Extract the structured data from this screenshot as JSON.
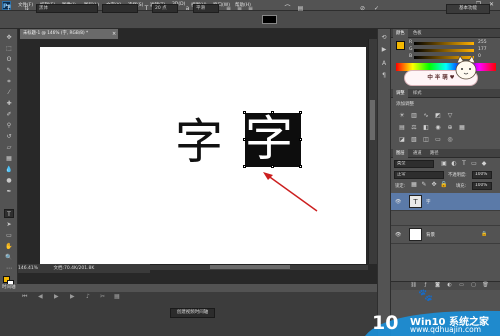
{
  "app": {
    "logo": "Ps"
  },
  "menu": [
    "文件(F)",
    "编辑(E)",
    "图像(I)",
    "图层(L)",
    "文字(Y)",
    "选择(S)",
    "滤镜(T)",
    "3D(D)",
    "视图(V)",
    "窗口(W)",
    "帮助(H)"
  ],
  "window_controls": [
    "—",
    "❐",
    "✕"
  ],
  "options": {
    "font_family": "黑体",
    "font_size": "20 点",
    "antialias": "平滑",
    "workspace": "基本功能"
  },
  "document": {
    "tab_title": "未标题-1 @ 146% (字, RGB/8) *",
    "zoom": "146.41%",
    "doc_info": "文档:70.4K/201.8K",
    "char_plain": "字",
    "char_selected": "字"
  },
  "timeline": {
    "title": "时间轴",
    "create_button": "创建视频时间轴"
  },
  "panels": {
    "color_tabs": [
      "颜色",
      "色板"
    ],
    "color_values": {
      "r": "255",
      "g": "177",
      "b": "0"
    },
    "sticker_text": "中 半 萌",
    "adjust_tabs": [
      "调整",
      "样式"
    ],
    "adjust_title": "添加调整",
    "layer_tabs": [
      "图层",
      "通道",
      "路径"
    ],
    "blend_mode": "正常",
    "opacity_label": "不透明度:",
    "opacity": "100%",
    "lock_label": "锁定:",
    "fill_label": "填充:",
    "fill": "100%",
    "kind_label": "类型",
    "layers": [
      {
        "name": "字",
        "thumb": "T",
        "selected": true
      },
      {
        "name": "背景",
        "thumb": "",
        "selected": false
      }
    ]
  },
  "watermark": {
    "number": "10",
    "line1": "Win10 系统之家",
    "line2": "www.qdhuajin.com"
  },
  "colors": {
    "fg": "#f5b800",
    "bg": "#ffffff",
    "arrow": "#cc1f1f",
    "layer_selected": "#5b7aa8"
  }
}
